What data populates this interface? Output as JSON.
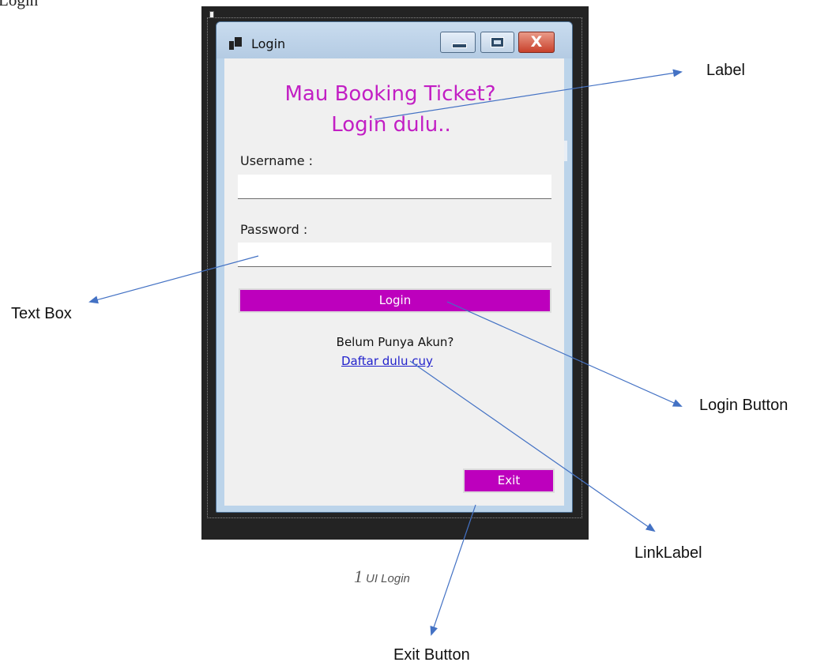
{
  "page": {
    "top_text": "Login",
    "caption_number": "1",
    "caption_text": "UI Login"
  },
  "window": {
    "title": "Login",
    "heading_line_1": "Mau Booking Ticket?",
    "heading_line_2": "Login dulu..",
    "username_label": "Username :",
    "username_value": "",
    "password_label": "Password :",
    "password_value": "",
    "login_button": "Login",
    "no_account_text": "Belum Punya Akun?",
    "register_link": "Daftar dulu cuy",
    "exit_button": "Exit",
    "close_glyph": "X"
  },
  "annotations": {
    "label": "Label",
    "text_box": "Text Box",
    "login_button": "Login Button",
    "link_label": "LinkLabel",
    "exit_button": "Exit Button"
  },
  "colors": {
    "accent": "#bd00bd",
    "heading": "#c21fc4",
    "link": "#2222cc",
    "arrow": "#4472c4",
    "designer_bg": "#232323"
  }
}
